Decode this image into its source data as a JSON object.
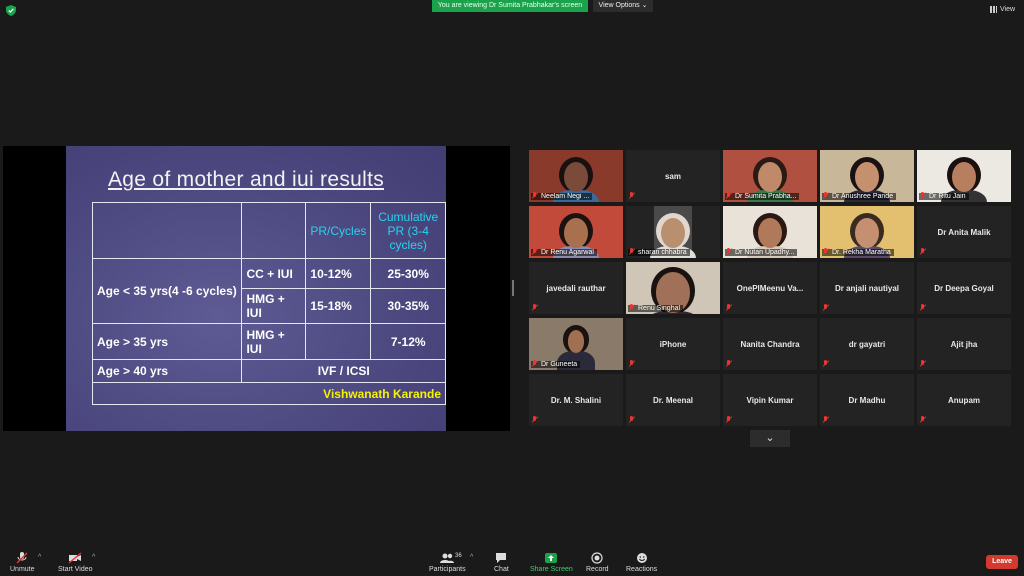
{
  "topbar": {
    "banner": "You are viewing Dr Sumita Prabhakar's screen",
    "view_options": "View Options ⌄",
    "view": "View"
  },
  "slide": {
    "title": "Age of mother and iui results",
    "header_pr": "PR/Cycles",
    "header_cum": "Cumulative PR (3-4 cycles)",
    "rows": [
      {
        "age": "Age < 35 yrs(4 -6 cycles)",
        "treat1": "CC + IUI",
        "pr1": "10-12%",
        "cum1": "25-30%",
        "treat2": "HMG + IUI",
        "pr2": "15-18%",
        "cum2": "30-35%"
      },
      {
        "age": "Age > 35 yrs",
        "treat": "HMG + IUI",
        "pr": "",
        "cum": "7-12%"
      },
      {
        "age": "Age > 40 yrs",
        "treat": "IVF / ICSI"
      }
    ],
    "author": "Vishwanath Karande"
  },
  "gallery": [
    [
      "Neelam Negi ...",
      "sam",
      "Dr Sumita Prabha...",
      "Dr Anushree Pande",
      "Dr Ritu Jain"
    ],
    [
      "Dr Renu Agarwal",
      "sharan chhabra",
      "Dr Nutan Upadhy...",
      "Dr. Rekha Maratha",
      "Dr Anita Malik"
    ],
    [
      "javedali rauthar",
      "Renu Singhal",
      "OnePlMeenu  Va...",
      "Dr anjali nautiyal",
      "Dr Deepa Goyal"
    ],
    [
      "Dr Guneeta",
      "iPhone",
      "Nanita Chandra",
      "dr gayatri",
      "Ajit jha"
    ],
    [
      "Dr. M. Shalini",
      "Dr. Meenal",
      "Vipin Kumar",
      "Dr Madhu",
      "Anupam"
    ]
  ],
  "toolbar": {
    "unmute": "Unmute",
    "start_video": "Start Video",
    "participants": "Participants",
    "participants_count": "36",
    "chat": "Chat",
    "share_screen": "Share Screen",
    "record": "Record",
    "reactions": "Reactions",
    "leave": "Leave"
  },
  "colors": {
    "banner": "#1aa34a",
    "share_screen": "#1aa34a",
    "leave": "#d33a2f",
    "active_speaker": "#b6e04a",
    "slide_cyan": "#25d4ee",
    "slide_yellow": "#f6f200"
  }
}
